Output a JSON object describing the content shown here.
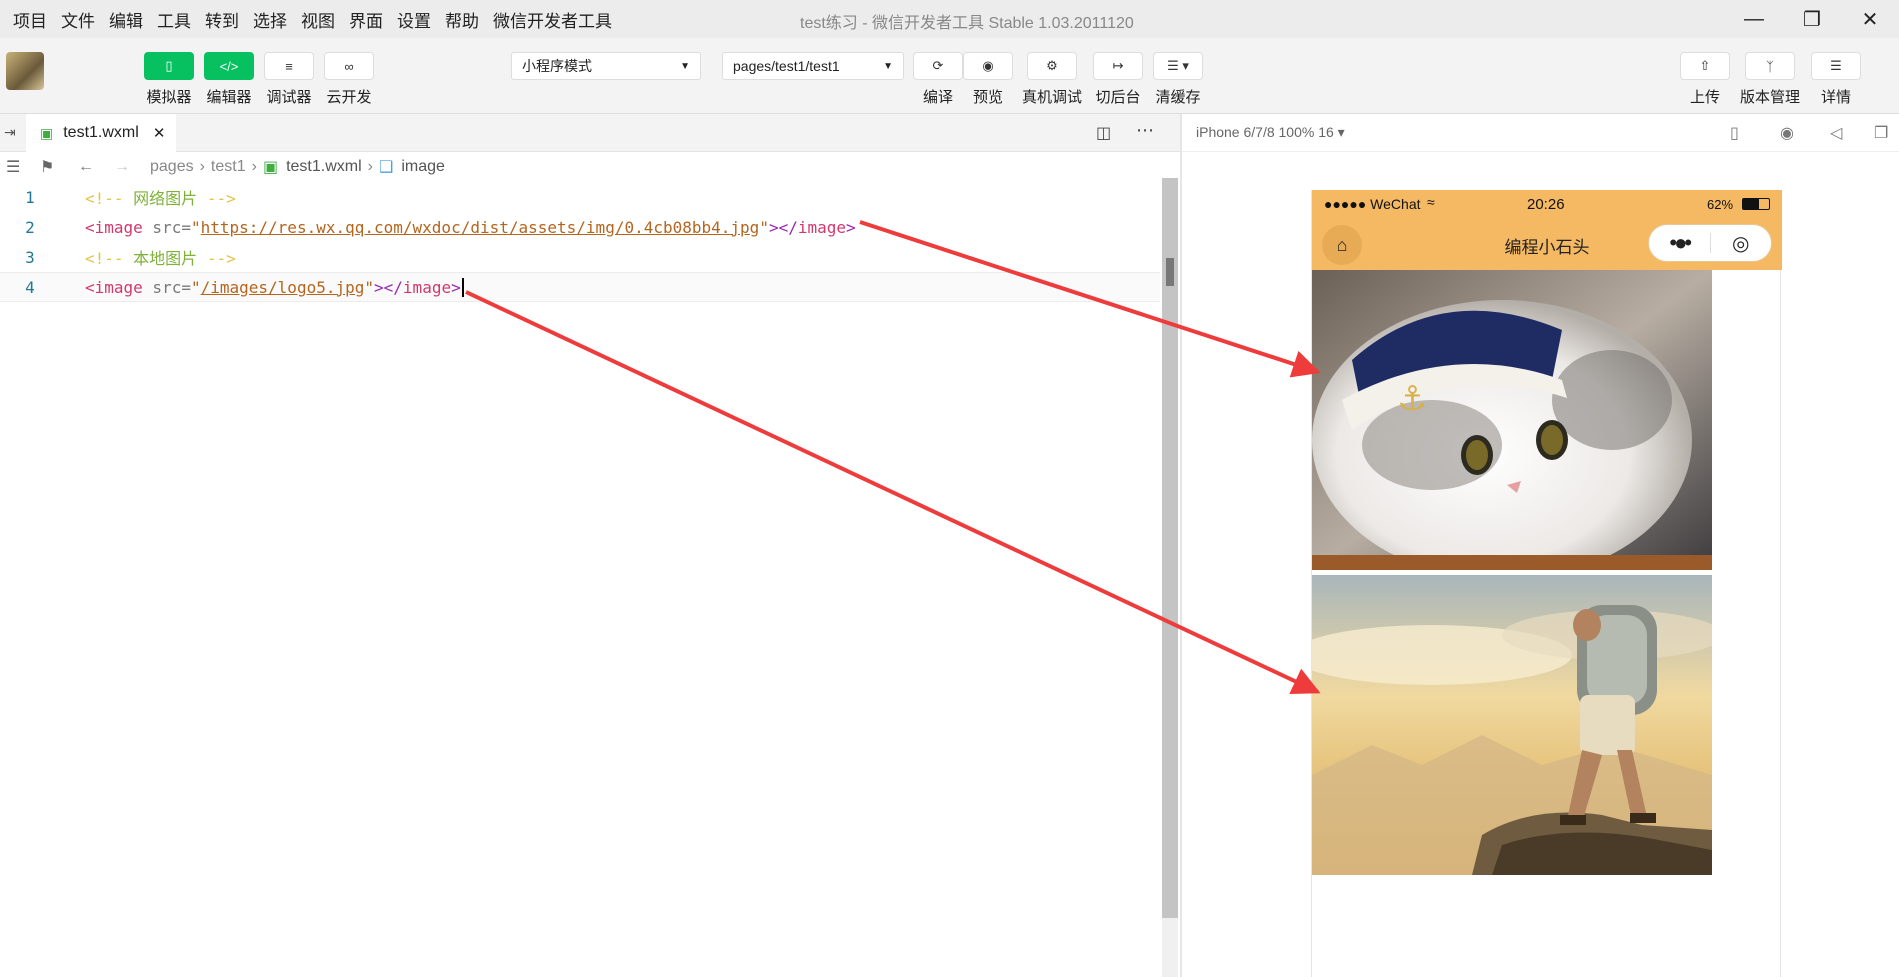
{
  "menu": [
    "项目",
    "文件",
    "编辑",
    "工具",
    "转到",
    "选择",
    "视图",
    "界面",
    "设置",
    "帮助",
    "微信开发者工具"
  ],
  "window_title": "test练习 - 微信开发者工具 Stable 1.03.2011120",
  "toolbar": {
    "simulator": "模拟器",
    "editor": "编辑器",
    "debugger": "调试器",
    "cloud": "云开发",
    "mode_select": "小程序模式",
    "page_select": "pages/test1/test1",
    "compile": "编译",
    "preview": "预览",
    "real_debug": "真机调试",
    "background": "切后台",
    "clear_cache": "清缓存",
    "upload": "上传",
    "version": "版本管理",
    "details": "详情"
  },
  "editor": {
    "tab_name": "test1.wxml",
    "breadcrumb": [
      "pages",
      "test1",
      "test1.wxml",
      "image"
    ],
    "line_numbers": [
      "1",
      "2",
      "3",
      "4"
    ],
    "comment1_open": "<!-- ",
    "comment1_text": "网络图片",
    "comment1_close": " -->",
    "tag_open": "<image",
    "attr": " src=",
    "quote": "\"",
    "url1": "https://res.wx.qq.com/wxdoc/dist/assets/img/0.4cb08bb4.jpg",
    "tag_mid": "></",
    "tag_name": "image",
    "tag_end": ">",
    "comment2_open": "<!-- ",
    "comment2_text": "本地图片",
    "comment2_close": " -->",
    "url2": "/images/logo5.jpg"
  },
  "simulator": {
    "device": "iPhone 6/7/8 100% 16 ▾",
    "carrier": "●●●●● WeChat",
    "time": "20:26",
    "battery": "62%",
    "nav_title": "编程小石头"
  },
  "colors": {
    "green": "#07c160",
    "nav_orange": "#f5b964",
    "arrow_red": "#ee3b3b"
  }
}
